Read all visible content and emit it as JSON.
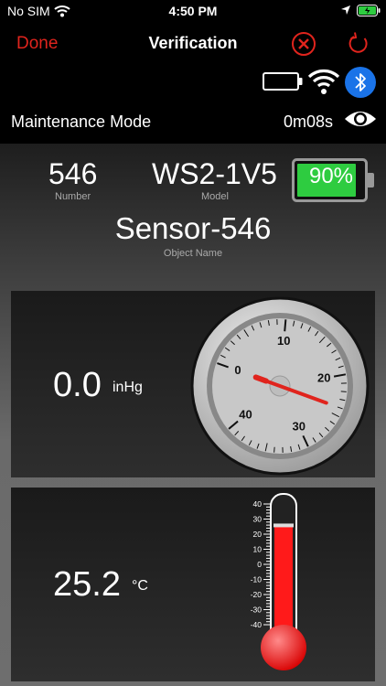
{
  "status_bar": {
    "carrier": "No SIM",
    "time": "4:50 PM"
  },
  "nav": {
    "done_label": "Done",
    "title": "Verification"
  },
  "mode": {
    "label": "Maintenance Mode",
    "timer": "0m08s"
  },
  "device": {
    "number": "546",
    "number_label": "Number",
    "model": "WS2-1V5",
    "model_label": "Model",
    "battery": "90%",
    "object_name": "Sensor-546",
    "object_name_label": "Object Name"
  },
  "pressure": {
    "value": "0.0",
    "unit": "inHg",
    "gauge_labels": [
      "0",
      "10",
      "20",
      "30",
      "40"
    ],
    "needle_level": 0.0
  },
  "temperature": {
    "value": "25.2",
    "unit": "°C",
    "scale_labels": [
      "40",
      "30",
      "20",
      "10",
      "0",
      "-10",
      "-20",
      "-30",
      "-40"
    ],
    "level": 25.2
  },
  "colors": {
    "accent_red": "#e0241d",
    "battery_green": "#2ecc40",
    "bluetooth_blue": "#1a73e8"
  }
}
